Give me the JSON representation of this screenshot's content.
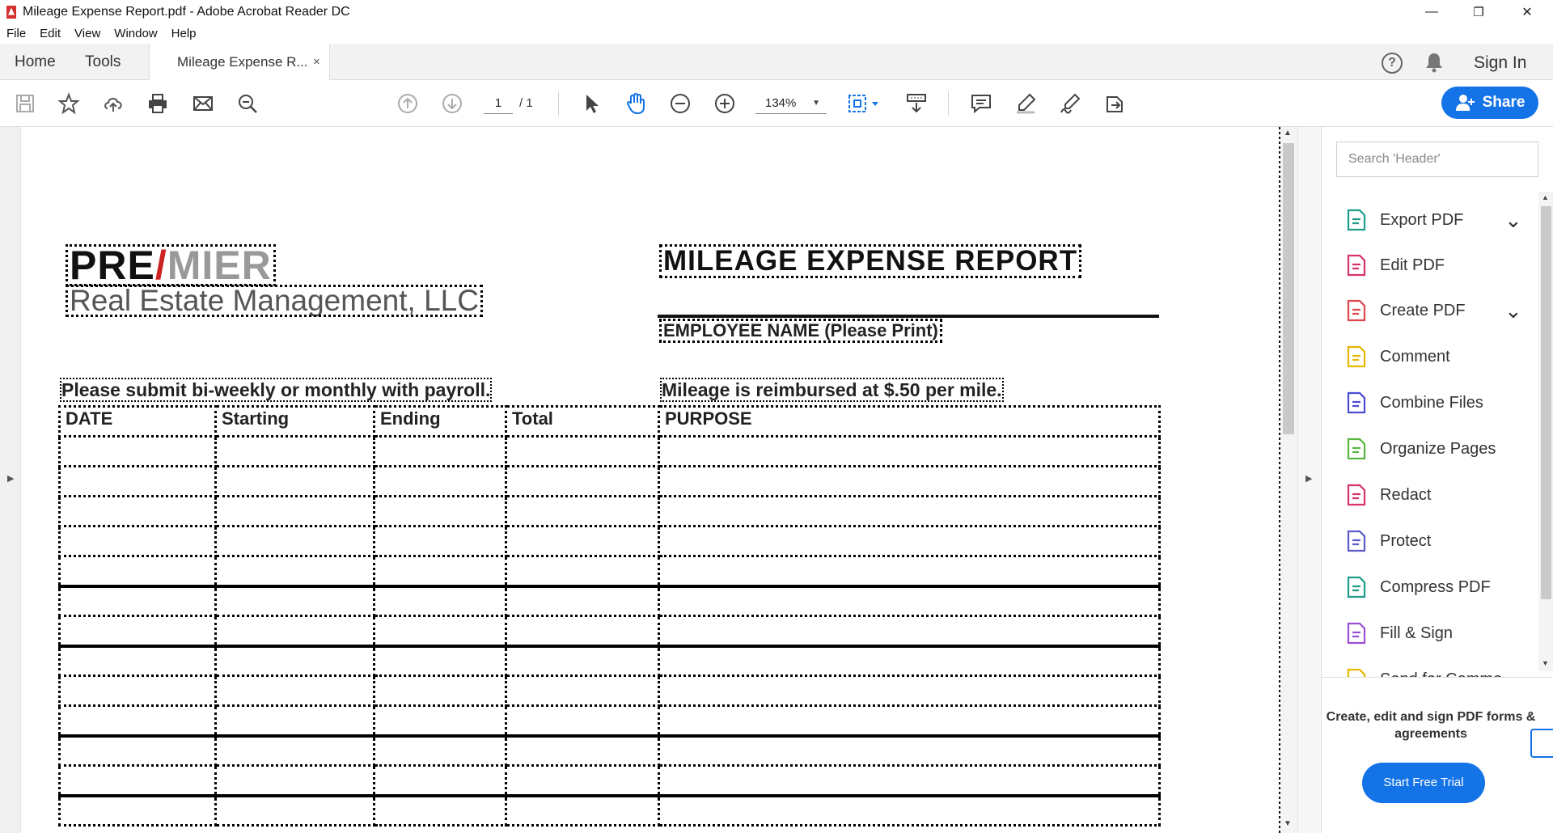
{
  "window": {
    "title": "Mileage Expense Report.pdf - Adobe Acrobat Reader DC",
    "controls": {
      "minimize": "—",
      "restore": "❐",
      "close": "✕"
    }
  },
  "menu": [
    "File",
    "Edit",
    "View",
    "Window",
    "Help"
  ],
  "tabs": {
    "home": "Home",
    "tools": "Tools",
    "document": "Mileage Expense R...",
    "close": "×"
  },
  "header_right": {
    "signin": "Sign In"
  },
  "toolbar": {
    "page_current": "1",
    "page_total": "/ 1",
    "zoom": "134%",
    "share_label": "Share",
    "icons": [
      "save-icon",
      "star-icon",
      "upload-icon",
      "print-icon",
      "email-icon",
      "search-icon",
      "page-up-icon",
      "page-down-icon",
      "select-cursor-icon",
      "hand-icon",
      "zoom-out-icon",
      "zoom-in-icon",
      "fit-page-icon",
      "scroll-mode-icon",
      "comment-icon",
      "highlight-icon",
      "sign-icon",
      "edit-send-icon"
    ]
  },
  "document": {
    "logo_main": "PRE",
    "logo_slash": "/",
    "logo_rest": "MIER",
    "logo_sub": "Real Estate Management, LLC",
    "report_title": "MILEAGE EXPENSE REPORT",
    "name_label": "EMPLOYEE NAME (Please Print)",
    "instr_left": "Please submit bi-weekly or monthly with payroll.",
    "instr_right": "Mileage is reimbursed at $.50 per mile.",
    "columns": [
      "DATE",
      "Starting",
      "Ending",
      "Total",
      "PURPOSE"
    ]
  },
  "tools_pane": {
    "search_placeholder": "Search 'Header'",
    "items": [
      {
        "label": "Export PDF",
        "icon": "export-pdf-icon",
        "color": "#1f9d8b",
        "expand": true
      },
      {
        "label": "Edit PDF",
        "icon": "edit-pdf-icon",
        "color": "#d6326c",
        "expand": false
      },
      {
        "label": "Create PDF",
        "icon": "create-pdf-icon",
        "color": "#e0474c",
        "expand": true
      },
      {
        "label": "Comment",
        "icon": "comment-icon",
        "color": "#e6b800",
        "expand": false
      },
      {
        "label": "Combine Files",
        "icon": "combine-files-icon",
        "color": "#4b4bd6",
        "expand": false
      },
      {
        "label": "Organize Pages",
        "icon": "organize-pages-icon",
        "color": "#5ab543",
        "expand": false
      },
      {
        "label": "Redact",
        "icon": "redact-icon",
        "color": "#d6326c",
        "expand": false
      },
      {
        "label": "Protect",
        "icon": "protect-icon",
        "color": "#5a5ac8",
        "expand": false
      },
      {
        "label": "Compress PDF",
        "icon": "compress-pdf-icon",
        "color": "#1f9d8b",
        "expand": false
      },
      {
        "label": "Fill & Sign",
        "icon": "fill-sign-icon",
        "color": "#9b4fd6",
        "expand": false
      },
      {
        "label": "Send for Comme",
        "icon": "send-comments-icon",
        "color": "#e6b800",
        "expand": false
      }
    ],
    "promo": "Create, edit and sign PDF forms & agreements",
    "trial_label": "Start Free Trial"
  },
  "colors": {
    "accent": "#1473e6"
  }
}
